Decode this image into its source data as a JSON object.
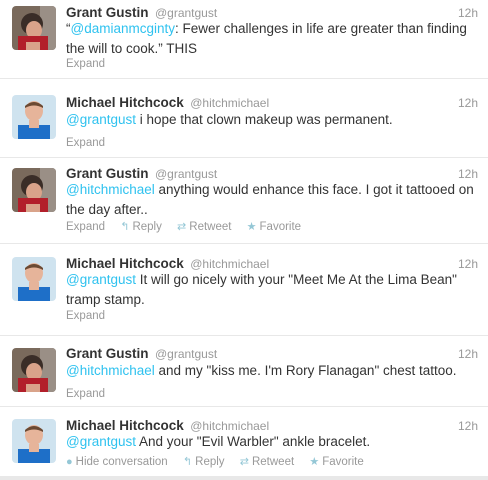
{
  "tweets": [
    {
      "name": "Grant Gustin",
      "handle": "@grantgust",
      "time": "12h",
      "mention": "@damianmcginty",
      "pre": "“",
      "text": ": Fewer challenges in life are greater than finding the will to cook.” THIS",
      "actions": {
        "expand": "Expand"
      }
    },
    {
      "name": "Michael Hitchcock",
      "handle": "@hitchmichael",
      "time": "12h",
      "mention": "@grantgust",
      "text": " i hope that clown makeup was permanent.",
      "actions": {
        "expand": "Expand"
      }
    },
    {
      "name": "Grant Gustin",
      "handle": "@grantgust",
      "time": "12h",
      "mention": "@hitchmichael",
      "text": " anything would enhance this face. I got it tattooed on the day after..",
      "actions": {
        "expand": "Expand",
        "reply": "Reply",
        "retweet": "Retweet",
        "favorite": "Favorite"
      }
    },
    {
      "name": "Michael Hitchcock",
      "handle": "@hitchmichael",
      "time": "12h",
      "mention": "@grantgust",
      "text": " It will go nicely with your \"Meet Me At the Lima Bean\" tramp stamp.",
      "actions": {
        "expand": "Expand"
      }
    },
    {
      "name": "Grant Gustin",
      "handle": "@grantgust",
      "time": "12h",
      "mention": "@hitchmichael",
      "text": " and my \"kiss me. I'm Rory Flanagan\" chest tattoo.",
      "actions": {
        "expand": "Expand"
      }
    },
    {
      "name": "Michael Hitchcock",
      "handle": "@hitchmichael",
      "time": "12h",
      "mention": "@grantgust",
      "text": " And your \"Evil Warbler\" ankle bracelet.",
      "actions": {
        "hide": "Hide conversation",
        "reply": "Reply",
        "retweet": "Retweet",
        "favorite": "Favorite"
      }
    }
  ],
  "icons": {
    "expand": "expand-icon",
    "reply": "reply-arrow-icon",
    "retweet": "retweet-icon",
    "favorite": "star-icon"
  },
  "colors": {
    "mention": "#2fc2ef",
    "meta": "#999999",
    "text": "#333333",
    "action_icon": "#94c7d6"
  }
}
